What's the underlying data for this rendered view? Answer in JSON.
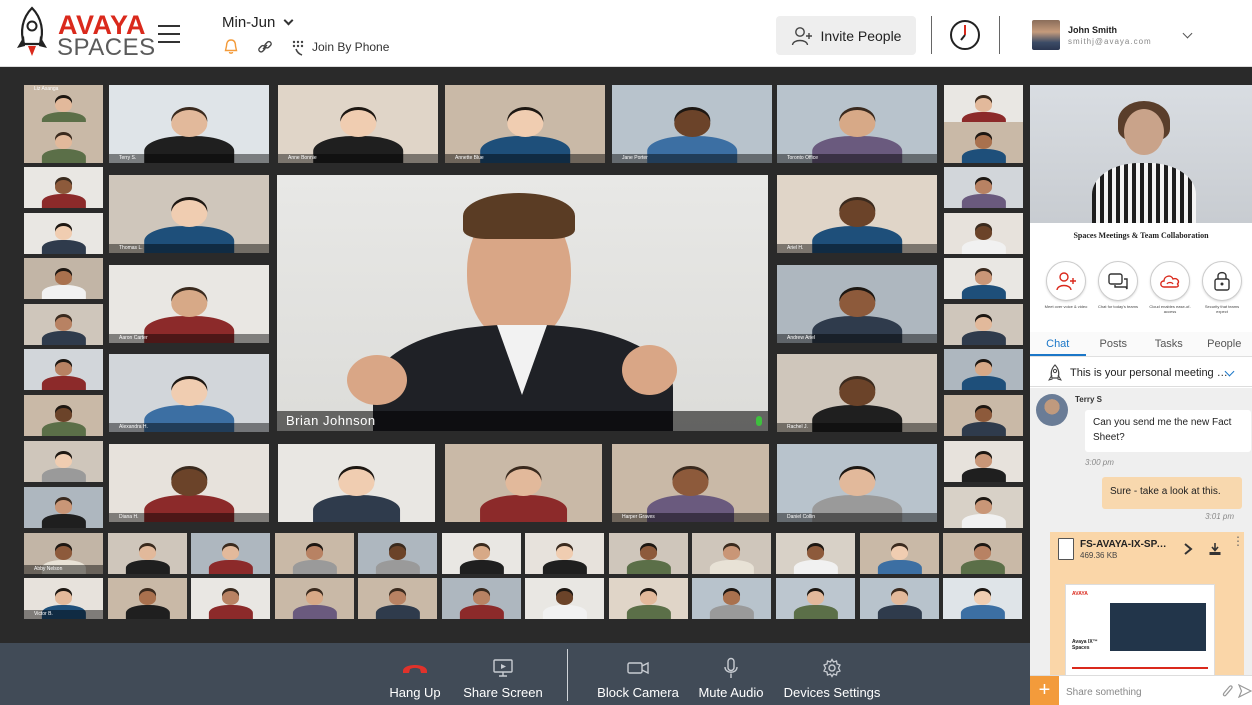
{
  "header": {
    "brand": "AVAYA",
    "product": "SPACES",
    "meeting_title": "Min-Jun",
    "join_by_phone": "Join By Phone",
    "invite_label": "Invite People",
    "user": {
      "name": "John Smith",
      "email": "smithj@avaya.com"
    }
  },
  "main_speaker": {
    "name": "Brian Johnson"
  },
  "participants": [
    "Liz Asanga",
    "Terry S.",
    "Anne Bonnie",
    "Annette Blue",
    "Jane Porter",
    "Toronto Office",
    "Thomas L.",
    "Ariel H.",
    "Aaron Carter",
    "Andrew Ariel",
    "Alexandra H.",
    "Rachel J.",
    "Diana H.",
    "Harper Graves",
    "Abby Nelson",
    "Victor B.",
    "Daniel Collin"
  ],
  "sidebar": {
    "tagline": "Spaces Meetings & Team Collaboration",
    "features": [
      {
        "icon": "add-person-icon",
        "label": "Meet over voice & video"
      },
      {
        "icon": "chat-bubbles-icon",
        "label": "Chat for today's teams"
      },
      {
        "icon": "cloud-icon",
        "label": "Cloud enables ease-of-access"
      },
      {
        "icon": "lock-icon",
        "label": "Security that teams expect"
      }
    ],
    "tabs": [
      "Chat",
      "Posts",
      "Tasks",
      "People"
    ],
    "active_tab": "Chat",
    "meeting_notice": "This is your personal meeting space",
    "chat": {
      "sender": "Terry S",
      "incoming_text": "Can you send me the new Fact Sheet?",
      "incoming_time": "3:00 pm",
      "outgoing_text": "Sure - take a look at this.",
      "outgoing_time": "3:01 pm",
      "file": {
        "name": "FS-AVAYA-IX-SPACES.pdf",
        "size": "469.36 KB",
        "preview_brand": "AVAYA",
        "preview_title": "Avaya IX™ Spaces"
      }
    },
    "compose_placeholder": "Share something"
  },
  "toolbar": {
    "hang_up": "Hang Up",
    "share_screen": "Share Screen",
    "block_camera": "Block Camera",
    "mute_audio": "Mute Audio",
    "devices_settings": "Devices Settings"
  },
  "colors": {
    "brand_red": "#da291c",
    "accent_blue": "#1b77c8",
    "hangup_red": "#e0322b",
    "toolbar_bg": "#414b57",
    "compose_orange": "#f39b3b"
  }
}
